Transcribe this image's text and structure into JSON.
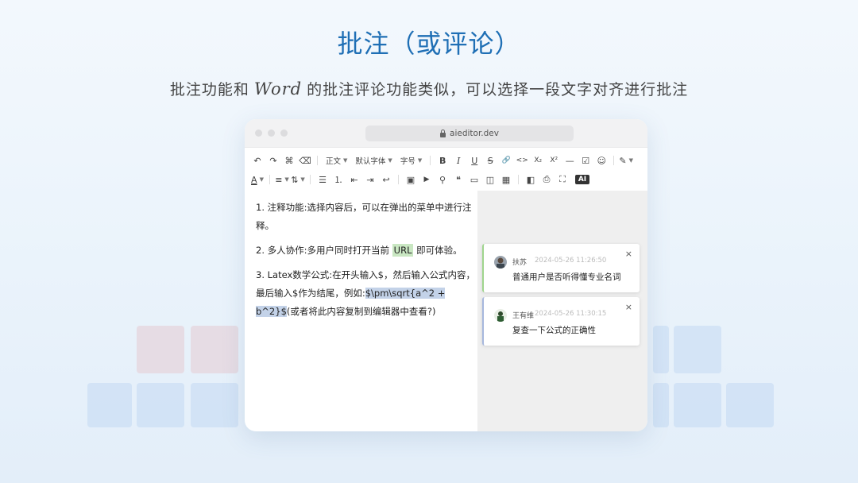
{
  "slide": {
    "title": "批注（或评论）",
    "subtitle_before": "批注功能和",
    "subtitle_word": "Word",
    "subtitle_after": "的批注评论功能类似，可以选择一段文字对齐进行批注"
  },
  "browser": {
    "url": "aieditor.dev"
  },
  "toolbar": {
    "row1": {
      "undo": "↶",
      "redo": "↷",
      "format_painter": "⌘",
      "clear_format": "⌫",
      "heading": "正文",
      "font_family": "默认字体",
      "font_size": "字号",
      "bold": "B",
      "italic": "I",
      "underline": "U",
      "strike": "S",
      "link": "🔗",
      "code": "<>",
      "subscript": "X₂",
      "superscript": "X²",
      "hr": "—",
      "todo": "☑",
      "emoji": "☺",
      "painter": "✎"
    },
    "row2": {
      "font_color": "A",
      "align": "≡",
      "line_height": "⇅",
      "bullet_list": "☰",
      "ordered_list": "⒈",
      "indent_decrease": "⇤",
      "indent_increase": "⇥",
      "break": "↩",
      "image": "▣",
      "video": "▶",
      "attachment": "⚲",
      "quote": "❝",
      "code_block": "▭",
      "container": "◫",
      "table": "▦",
      "source": "◧",
      "print": "⎙",
      "fullscreen": "⛶",
      "ai": "AI"
    }
  },
  "content": {
    "p1": "1. 注释功能:选择内容后，可以在弹出的菜单中进行注释。",
    "p2_before": "2. 多人协作:多用户同时打开当前 ",
    "p2_highlight": "URL",
    "p2_after": " 即可体验。",
    "p3_before": "3. Latex数学公式:在开头输入$，然后输入公式内容，最后输入$作为结尾，例如:",
    "p3_highlight": "$\\pm\\sqrt{a^2 + b^2}$",
    "p3_after": "(或者将此内容复制到编辑器中查看?)"
  },
  "comments": [
    {
      "author": "扶苏",
      "time": "2024-05-26 11:26:50",
      "text": "普通用户是否听得懂专业名词",
      "close": "×",
      "accent": "#9fd58d"
    },
    {
      "author": "王有维",
      "time": "2024-05-26 11:30:15",
      "text": "复查一下公式的正确性",
      "close": "×",
      "accent": "#a6b7dd"
    }
  ]
}
